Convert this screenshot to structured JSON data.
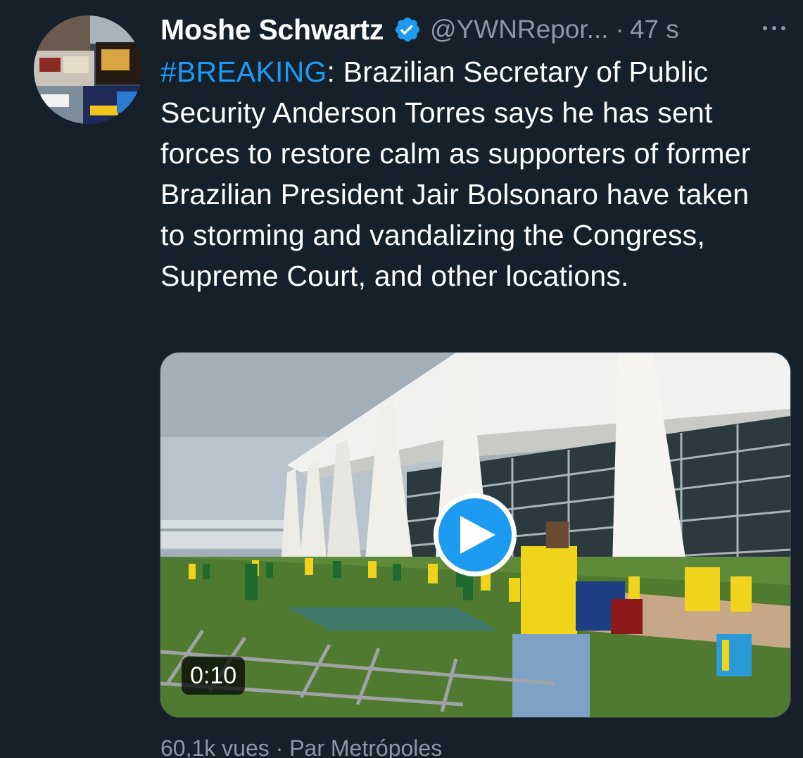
{
  "author": {
    "name": "Moshe Schwartz",
    "handle": "@YWNRepor...",
    "separator": "·",
    "time": "47 s",
    "verified": true
  },
  "tweet": {
    "hashtag": "#BREAKING",
    "text": ": Brazilian Secretary of Public Security Anderson Torres says he has sent forces to restore calm as supporters of former Brazilian President Jair Bolsonaro have taken to storming and vandalizing the Congress, Supreme Court, and other locations."
  },
  "media": {
    "type": "video",
    "duration": "0:10"
  },
  "footer": {
    "views": "60,1k vues",
    "separator": "·",
    "source": "Par Metrópoles"
  },
  "colors": {
    "background": "#15202b",
    "accent": "#1d9bf0",
    "secondary_text": "#8b98a5",
    "primary_text": "#ffffff"
  },
  "icons": {
    "verified": "verified-badge-icon",
    "more": "more-horizontal-icon",
    "play": "play-icon"
  }
}
